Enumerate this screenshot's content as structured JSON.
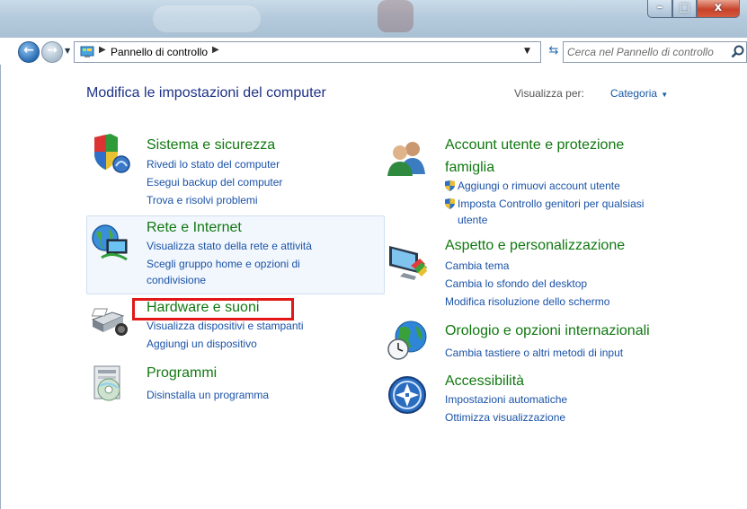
{
  "window": {
    "min_glyph": "–",
    "max_glyph": "□",
    "close_glyph": "x"
  },
  "navbar": {
    "breadcrumb": "Pannello di controllo",
    "search_placeholder": "Cerca nel Pannello di controllo"
  },
  "header": {
    "title": "Modifica le impostazioni del computer",
    "view_by_label": "Visualizza per:",
    "view_by_value": "Categoria"
  },
  "categories": [
    {
      "title": "Sistema e sicurezza",
      "icon": "shield-pc-icon",
      "links": [
        "Rivedi lo stato del computer",
        "Esegui backup del computer",
        "Trova e risolvi problemi"
      ]
    },
    {
      "title": "Rete e Internet",
      "icon": "network-globe-icon",
      "links": [
        "Visualizza stato della rete e attività",
        "Scegli gruppo home e opzioni di",
        "condivisione"
      ]
    },
    {
      "title": "Hardware e suoni",
      "icon": "printer-speaker-icon",
      "links": [
        "Visualizza dispositivi e stampanti",
        "Aggiungi un dispositivo"
      ]
    },
    {
      "title": "Programmi",
      "icon": "programs-disc-icon",
      "links": [
        "Disinstalla un programma"
      ]
    },
    {
      "title_line1": "Account utente e protezione",
      "title_line2": "famiglia",
      "icon": "users-icon",
      "links": [
        "Aggiungi o rimuovi account utente",
        "Imposta Controllo genitori per qualsiasi",
        "utente"
      ]
    },
    {
      "title": "Aspetto e personalizzazione",
      "icon": "display-paint-icon",
      "links": [
        "Cambia tema",
        "Cambia lo sfondo del desktop",
        "Modifica risoluzione dello schermo"
      ]
    },
    {
      "title": "Orologio e opzioni internazionali",
      "icon": "clock-globe-icon",
      "links": [
        "Cambia tastiere o altri metodi di input"
      ]
    },
    {
      "title": "Accessibilità",
      "icon": "accessibility-icon",
      "links": [
        "Impostazioni automatiche",
        "Ottimizza visualizzazione"
      ]
    }
  ],
  "colors": {
    "category_title": "#107810",
    "link": "#1a52a7",
    "page_title": "#1e3287",
    "highlight_box": "#e21818"
  }
}
